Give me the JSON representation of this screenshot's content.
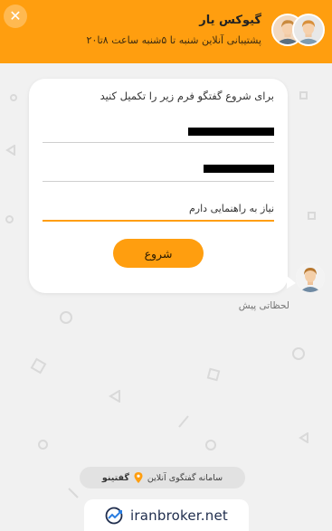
{
  "header": {
    "title": "گیوکس یار",
    "subtitle": "پشتیبانی آنلاین شنبه تا ۵شنبه ساعت ۸تا۲۰",
    "close_icon": "close-icon",
    "bg_color": "#ff9e0f"
  },
  "form": {
    "intro": "برای شروع گفتگو فرم زیر را تکمیل کنید",
    "name_value": "",
    "phone_value": "",
    "message_value": "نیاز به راهنمایی دارم",
    "start_label": "شروع",
    "accent_color": "#ff9e0f"
  },
  "message": {
    "time": "لحظاتی پیش"
  },
  "footer": {
    "powered_text": "سامانه گفتگوی آنلاین",
    "brand": "گفتینو",
    "watermark": "iranbroker.net"
  }
}
